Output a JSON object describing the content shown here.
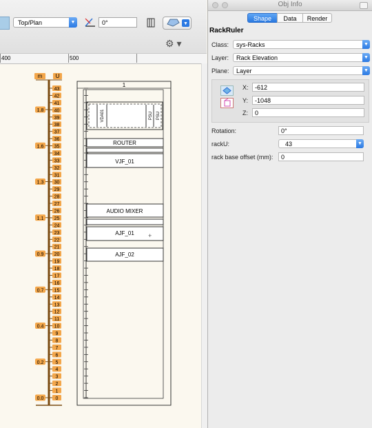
{
  "toolbar": {
    "view_select": "Top/Plan",
    "angle_value": "0°",
    "ruler_labels": [
      "400",
      "500"
    ]
  },
  "drawing": {
    "scale_m_header": "m",
    "scale_u_header": "U",
    "rack_number": "1",
    "m_labels": [
      "1.8",
      "1.6",
      "1.3",
      "1.1",
      "0.9",
      "0.7",
      "0.4",
      "0.2",
      "0.0"
    ],
    "u_max": 43,
    "equipment": {
      "vda": "VDA01",
      "psu1": "PSU",
      "psu2": "PSU",
      "router": "ROUTER",
      "vjf": "VJF_01",
      "audio_mixer": "AUDIO MIXER",
      "ajf1": "AJF_01",
      "ajf2": "AJF_02"
    }
  },
  "obj_info": {
    "window_title": "Obj Info",
    "tabs": [
      "Shape",
      "Data",
      "Render"
    ],
    "active_tab": "Shape",
    "object_type": "RackRuler",
    "class_label": "Class:",
    "class_value": "sys-Racks",
    "layer_label": "Layer:",
    "layer_value": "Rack Elevation",
    "plane_label": "Plane:",
    "plane_value": "Layer",
    "x_label": "X:",
    "x_value": "-612",
    "y_label": "Y:",
    "y_value": "-1048",
    "z_label": "Z:",
    "z_value": "0",
    "rotation_label": "Rotation:",
    "rotation_value": "0°",
    "racku_label": "rackU:",
    "racku_value": "43",
    "offset_label": "rack base offset (mm):",
    "offset_value": "0"
  },
  "colors": {
    "accent_blue": "#2c7ae3",
    "ruler_orange": "#f3a64a",
    "ruler_brown": "#7a4a10"
  }
}
